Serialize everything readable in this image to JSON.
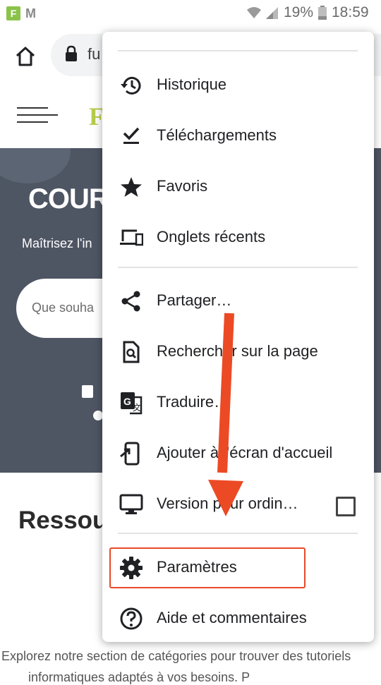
{
  "status_bar": {
    "app_icon_f": "F",
    "app_icon_m": "M",
    "battery_percent": "19%",
    "time": "18:59"
  },
  "browser": {
    "url_fragment": "fu"
  },
  "page": {
    "logo_fragment": "F",
    "hero_title": "COUR",
    "hero_subtitle": "Maîtrisez l'in",
    "search_placeholder": "Que souha",
    "resources_heading": "Ressou",
    "footer_text": "Explorez notre section de catégories pour trouver des tutoriels",
    "footer_text_2": "informatiques adaptés à vos besoins. P"
  },
  "menu": {
    "items": [
      {
        "label": "Historique",
        "icon": "history-icon"
      },
      {
        "label": "Téléchargements",
        "icon": "download-icon"
      },
      {
        "label": "Favoris",
        "icon": "star-icon"
      },
      {
        "label": "Onglets récents",
        "icon": "devices-icon"
      },
      {
        "label": "Partager…",
        "icon": "share-icon"
      },
      {
        "label": "Rechercher sur la page",
        "icon": "find-in-page-icon"
      },
      {
        "label": "Traduire…",
        "icon": "translate-icon"
      },
      {
        "label": "Ajouter à l'écran d'accueil",
        "icon": "add-to-home-icon"
      },
      {
        "label": "Version pour ordin…",
        "icon": "desktop-icon",
        "checked": false
      },
      {
        "label": "Paramètres",
        "icon": "gear-icon"
      },
      {
        "label": "Aide et commentaires",
        "icon": "help-icon"
      }
    ]
  },
  "colors": {
    "highlight": "#e8492a",
    "hero_bg": "#4e5563",
    "logo": "#b5cc4a"
  }
}
